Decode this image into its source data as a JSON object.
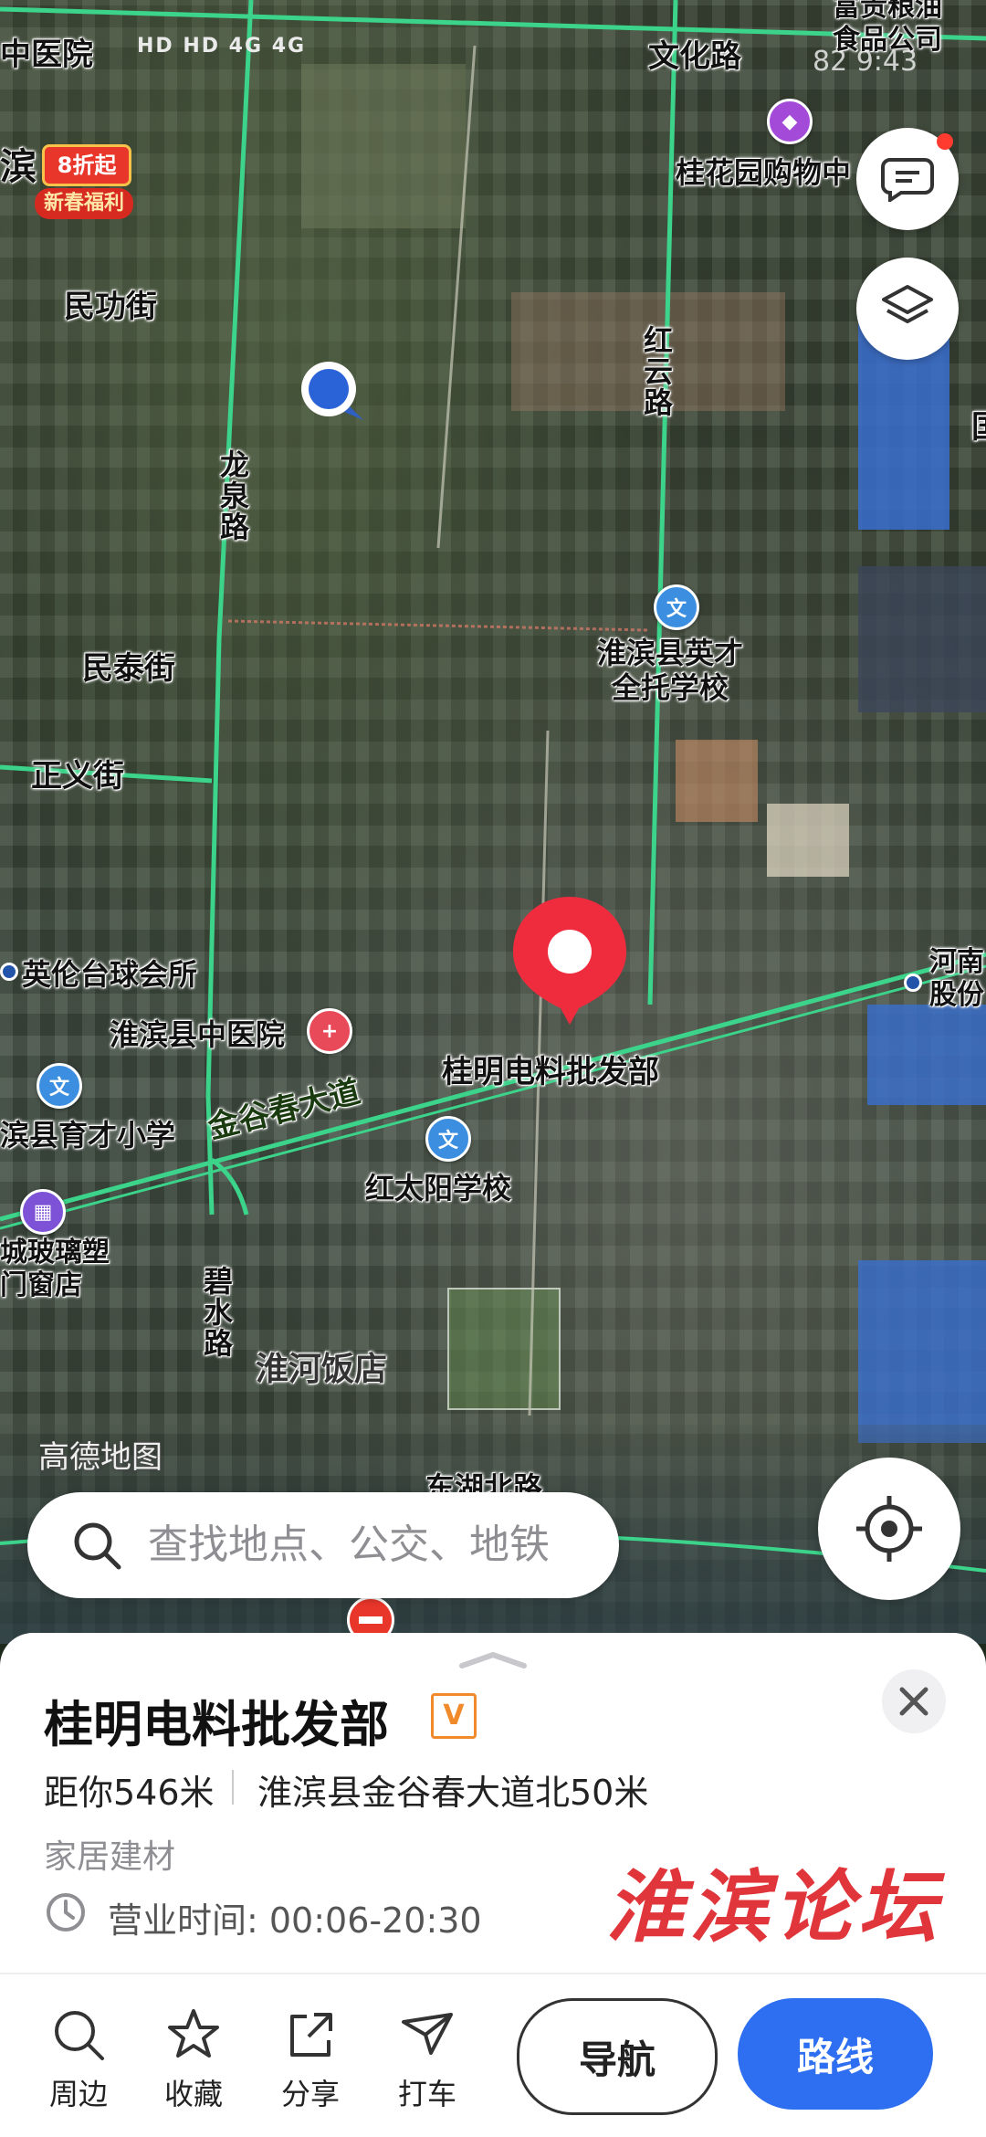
{
  "status_bar": {
    "left_text": "HD HD 4G 4G",
    "right_text": "82 9:43"
  },
  "map": {
    "promo_badge": {
      "top": "8折起",
      "bottom": "新春福利"
    },
    "watermark": "高德地图",
    "labels": {
      "hospital_top": "中医院",
      "wenhua_road": "文化路",
      "food_company": "富贵粮油\n食品公司",
      "guihua_mall": "桂花园购物中",
      "binxian_top": "滨",
      "minggong": "民功街",
      "hongyun": "红云路",
      "longquan": "龙泉路",
      "mintai": "民泰街",
      "yingcai": "淮滨县英才\n全托学校",
      "zhengyi": "正义街",
      "yinglun": "英伦台球会所",
      "hospital": "淮滨县中医院",
      "guiming_map": "桂明电料批发部",
      "jinguchun": "金谷春大道",
      "yucai": "滨县育才小学",
      "hongtaiyang": "红太阳学校",
      "glass": "城玻璃塑\n门窗店",
      "bishui": "碧水路",
      "huaihe_hotel": "淮河饭店",
      "donghu": "东湖北路",
      "henan": "河南\n股份",
      "right_edge": "国"
    }
  },
  "search": {
    "placeholder": "查找地点、公交、地铁"
  },
  "place_card": {
    "name": "桂明电料批发部",
    "badge": "V",
    "distance": "距你546米",
    "address": "淮滨县金谷春大道北50米",
    "category": "家居建材",
    "hours": "营业时间: 00:06-20:30",
    "watermark": "淮滨论坛"
  },
  "bottom_bar": {
    "nearby": "周边",
    "favorite": "收藏",
    "share": "分享",
    "taxi": "打车",
    "navigate": "导航",
    "route": "路线"
  },
  "colors": {
    "road_line": "#3bd48a",
    "primary_blue": "#2d6ff0",
    "pin_red": "#ef2c3e",
    "watermark_red": "#e0353a"
  }
}
